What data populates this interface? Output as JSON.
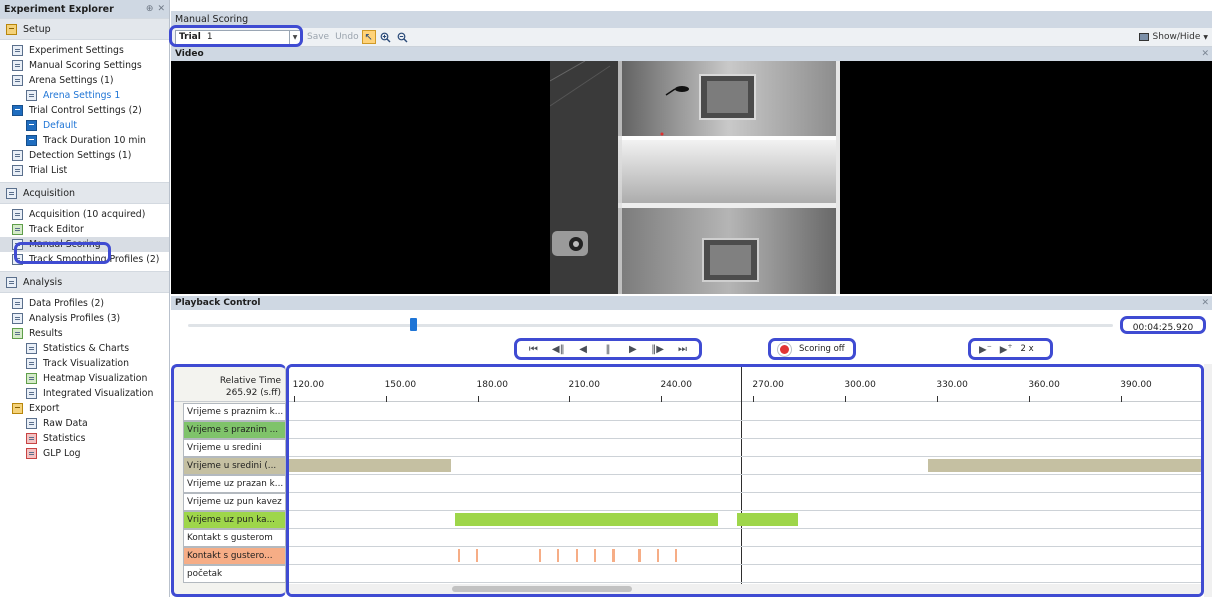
{
  "explorer": {
    "title": "Experiment Explorer",
    "pin_glyph": "⊕",
    "close_glyph": "✕",
    "sections": [
      {
        "label": "Setup",
        "icon": "setup-icon",
        "items": [
          {
            "label": "Experiment Settings",
            "indent": 1,
            "icon": "settings-icon"
          },
          {
            "label": "Manual Scoring Settings",
            "indent": 1,
            "icon": "settings-icon"
          },
          {
            "label": "Arena Settings (1)",
            "indent": 1,
            "icon": "arena-icon"
          },
          {
            "label": "Arena Settings 1",
            "indent": 2,
            "icon": "arena-icon",
            "link": true
          },
          {
            "label": "Trial Control Settings (2)",
            "indent": 1,
            "icon": "trial-control-icon"
          },
          {
            "label": "Default",
            "indent": 2,
            "icon": "trial-control-icon",
            "link": true
          },
          {
            "label": "Track Duration 10 min",
            "indent": 2,
            "icon": "trial-control-icon"
          },
          {
            "label": "Detection Settings (1)",
            "indent": 1,
            "icon": "detection-icon"
          },
          {
            "label": "Trial List",
            "indent": 1,
            "icon": "list-icon"
          }
        ]
      },
      {
        "label": "Acquisition",
        "icon": "acquisition-icon",
        "items": [
          {
            "label": "Acquisition (10 acquired)",
            "indent": 1,
            "icon": "acquisition-icon"
          },
          {
            "label": "Track Editor",
            "indent": 1,
            "icon": "track-editor-icon"
          },
          {
            "label": "Manual Scoring",
            "indent": 1,
            "icon": "manual-scoring-icon",
            "selected": true
          },
          {
            "label": "Track Smoothing Profiles (2)",
            "indent": 1,
            "icon": "smoothing-icon"
          }
        ]
      },
      {
        "label": "Analysis",
        "icon": "analysis-icon",
        "items": [
          {
            "label": "Data Profiles (2)",
            "indent": 1,
            "icon": "profile-icon"
          },
          {
            "label": "Analysis Profiles (3)",
            "indent": 1,
            "icon": "profile-icon"
          },
          {
            "label": "Results",
            "indent": 1,
            "icon": "results-icon"
          },
          {
            "label": "Statistics & Charts",
            "indent": 2,
            "icon": "chart-icon"
          },
          {
            "label": "Track Visualization",
            "indent": 2,
            "icon": "track-icon"
          },
          {
            "label": "Heatmap Visualization",
            "indent": 2,
            "icon": "heatmap-icon"
          },
          {
            "label": "Integrated Visualization",
            "indent": 2,
            "icon": "integrated-icon"
          },
          {
            "label": "Export",
            "indent": 1,
            "icon": "export-icon"
          },
          {
            "label": "Raw Data",
            "indent": 2,
            "icon": "raw-data-icon"
          },
          {
            "label": "Statistics",
            "indent": 2,
            "icon": "statistics-icon"
          },
          {
            "label": "GLP Log",
            "indent": 2,
            "icon": "log-icon"
          }
        ]
      }
    ]
  },
  "document": {
    "tab_title": "Manual Scoring"
  },
  "toolbar": {
    "trial_label": "Trial",
    "trial_value": "1",
    "save_label": "Save",
    "undo_label": "Undo",
    "show_hide_label": "Show/Hide",
    "select_icon": "pointer-icon",
    "zoom_in_icon": "zoom-in-icon",
    "zoom_out_icon": "zoom-out-icon"
  },
  "video_panel": {
    "title": "Video",
    "close_glyph": "✕"
  },
  "playback": {
    "title": "Playback Control",
    "close_glyph": "✕",
    "time": "00:04:25.920",
    "seek_fraction": 0.24,
    "scoring_label": "Scoring off",
    "speed_label": "2 x",
    "transport_buttons": [
      {
        "name": "skip-to-start",
        "glyph": "⏮"
      },
      {
        "name": "step-back",
        "glyph": "◀‖"
      },
      {
        "name": "play-backward",
        "glyph": "◀"
      },
      {
        "name": "pause",
        "glyph": "‖"
      },
      {
        "name": "play",
        "glyph": "▶"
      },
      {
        "name": "step-forward",
        "glyph": "‖▶"
      },
      {
        "name": "skip-to-end",
        "glyph": "⏭"
      }
    ]
  },
  "scoring_grid": {
    "relative_time_title": "Relative Time",
    "relative_time_value": "265.92 (s.ff)",
    "ticks": [
      "120.00",
      "150.00",
      "180.00",
      "210.00",
      "240.00",
      "270.00",
      "300.00",
      "330.00",
      "360.00",
      "390.00"
    ],
    "time_range": [
      118.5,
      416
    ],
    "playhead": 265.92,
    "rows": [
      {
        "label": "Vrijeme s praznim k...",
        "color": "#ffffff",
        "bars": []
      },
      {
        "label": "Vrijeme s praznim ...",
        "color": "#7fc36a",
        "bars": []
      },
      {
        "label": "Vrijeme u sredini",
        "color": "#ffffff",
        "bars": []
      },
      {
        "label": "Vrijeme u sredini  (...",
        "color": "#c5c0a2",
        "bars": [
          [
            118.5,
            171.5
          ],
          [
            327,
            416
          ]
        ]
      },
      {
        "label": "Vrijeme uz prazan k...",
        "color": "#ffffff",
        "bars": []
      },
      {
        "label": "Vrijeme uz pun kavez",
        "color": "#ffffff",
        "bars": []
      },
      {
        "label": "Vrijeme uz pun ka...",
        "color": "#9ed64a",
        "bars": [
          [
            172.5,
            258.5
          ],
          [
            264.5,
            284.5
          ]
        ]
      },
      {
        "label": "Kontakt s gusterom",
        "color": "#ffffff",
        "bars": []
      },
      {
        "label": "Kontakt s gustero...",
        "color": "#f6ad86",
        "bars": [
          [
            173.5,
            174.2
          ],
          [
            179.5,
            180.2
          ],
          [
            200,
            200.7
          ],
          [
            206,
            206.7
          ],
          [
            212,
            212.7
          ],
          [
            218,
            218.7
          ],
          [
            224,
            224.7
          ],
          [
            232.5,
            233.2
          ],
          [
            238.5,
            239.2
          ],
          [
            244.5,
            245.2
          ]
        ]
      },
      {
        "label": "početak",
        "color": "#ffffff",
        "bars": []
      }
    ]
  }
}
